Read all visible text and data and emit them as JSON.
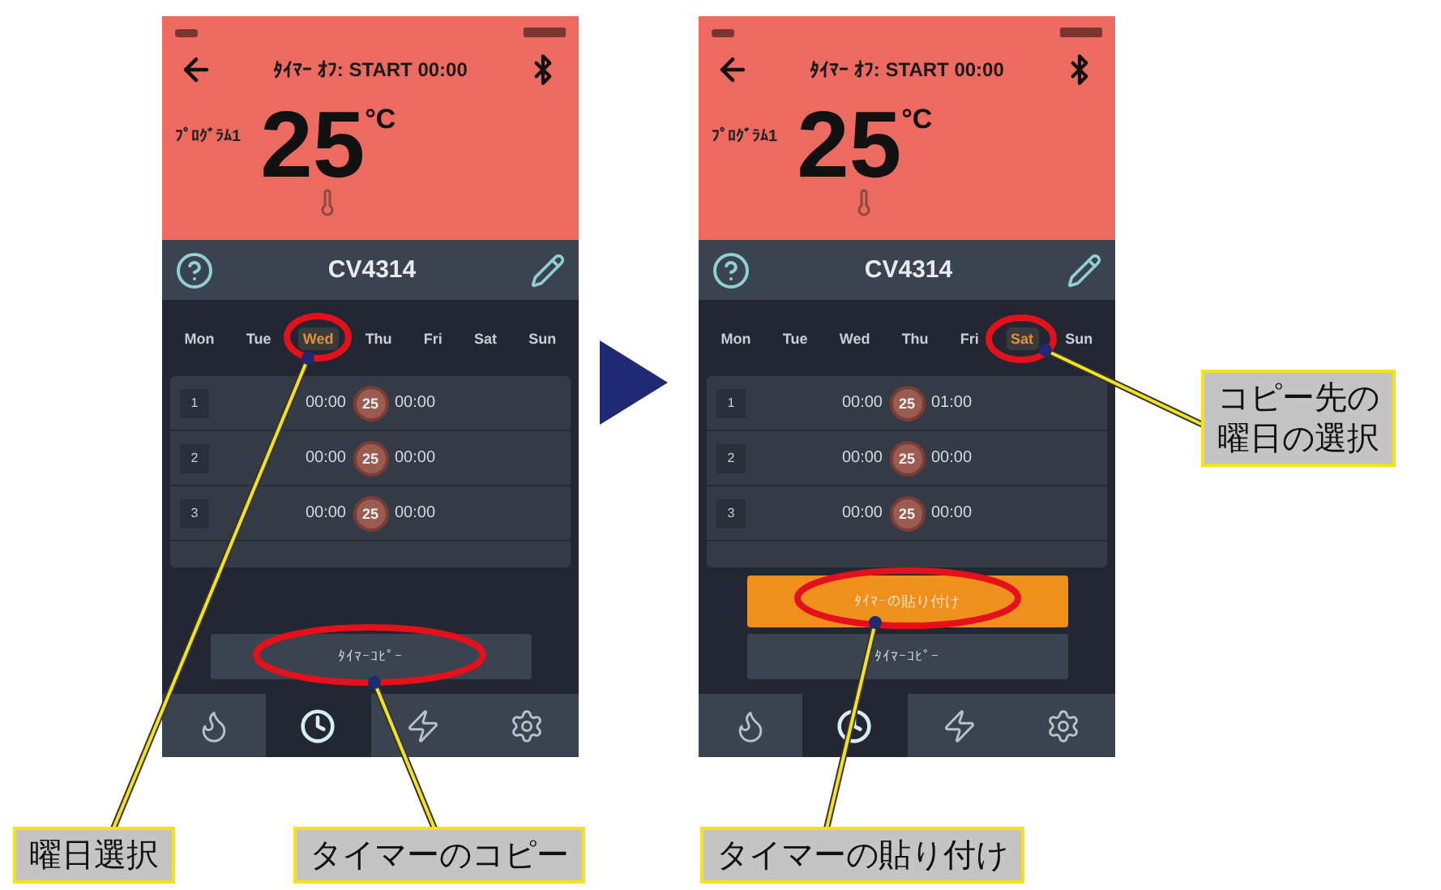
{
  "phones": [
    {
      "header_title": "ﾀｲﾏｰ ｵﾌ: START 00:00",
      "program_label": "ﾌﾟﾛｸﾞﾗﾑ1",
      "temperature": "25",
      "unit": "°C",
      "device_name": "CV4314",
      "days": [
        {
          "label": "Mon",
          "selected": false
        },
        {
          "label": "Tue",
          "selected": false
        },
        {
          "label": "Wed",
          "selected": true
        },
        {
          "label": "Thu",
          "selected": false
        },
        {
          "label": "Fri",
          "selected": false
        },
        {
          "label": "Sat",
          "selected": false
        },
        {
          "label": "Sun",
          "selected": false
        }
      ],
      "timers": [
        {
          "index": "1",
          "start": "00:00",
          "temp": "25",
          "end": "00:00"
        },
        {
          "index": "2",
          "start": "00:00",
          "temp": "25",
          "end": "00:00"
        },
        {
          "index": "3",
          "start": "00:00",
          "temp": "25",
          "end": "00:00"
        }
      ],
      "buttons": [
        {
          "kind": "copy",
          "label": "ﾀｲﾏｰｺﾋﾟｰ"
        }
      ],
      "tabs": [
        {
          "selected": false
        },
        {
          "selected": true
        },
        {
          "selected": false
        },
        {
          "selected": false
        }
      ]
    },
    {
      "header_title": "ﾀｲﾏｰ ｵﾌ: START 00:00",
      "program_label": "ﾌﾟﾛｸﾞﾗﾑ1",
      "temperature": "25",
      "unit": "°C",
      "device_name": "CV4314",
      "days": [
        {
          "label": "Mon",
          "selected": false
        },
        {
          "label": "Tue",
          "selected": false
        },
        {
          "label": "Wed",
          "selected": false
        },
        {
          "label": "Thu",
          "selected": false
        },
        {
          "label": "Fri",
          "selected": false
        },
        {
          "label": "Sat",
          "selected": true
        },
        {
          "label": "Sun",
          "selected": false
        }
      ],
      "timers": [
        {
          "index": "1",
          "start": "00:00",
          "temp": "25",
          "end": "01:00"
        },
        {
          "index": "2",
          "start": "00:00",
          "temp": "25",
          "end": "00:00"
        },
        {
          "index": "3",
          "start": "00:00",
          "temp": "25",
          "end": "00:00"
        }
      ],
      "buttons": [
        {
          "kind": "paste",
          "label": "ﾀｲﾏｰの貼り付け"
        },
        {
          "kind": "copy",
          "label": "ﾀｲﾏｰｺﾋﾟｰ"
        }
      ],
      "tabs": [
        {
          "selected": false
        },
        {
          "selected": true
        },
        {
          "selected": false
        },
        {
          "selected": false
        }
      ]
    }
  ],
  "callouts": [
    {
      "lines": [
        "曜日選択"
      ]
    },
    {
      "lines": [
        "タイマーのコピー"
      ]
    },
    {
      "lines": [
        "タイマーの貼り付け"
      ]
    },
    {
      "lines": [
        "コピー先の",
        "曜日の選択"
      ]
    }
  ]
}
